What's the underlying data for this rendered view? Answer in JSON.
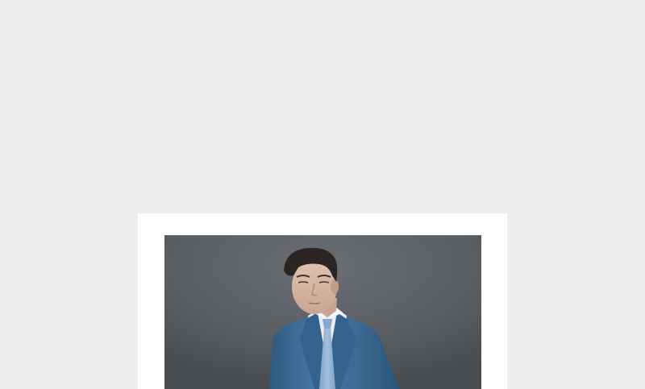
{
  "page": {
    "background_color": "#eeeeee"
  },
  "card": {
    "background_color": "#ffffff"
  },
  "photo": {
    "subject": "fashion-photo-man-in-blue-suit",
    "backdrop_color": "#5b5f63",
    "suit_color": "#3f6f98",
    "shirt_color": "#e8edf4",
    "tie_color": "#8fb2d4",
    "hair_color": "#2b2624",
    "skin_color": "#d8b8a6"
  }
}
